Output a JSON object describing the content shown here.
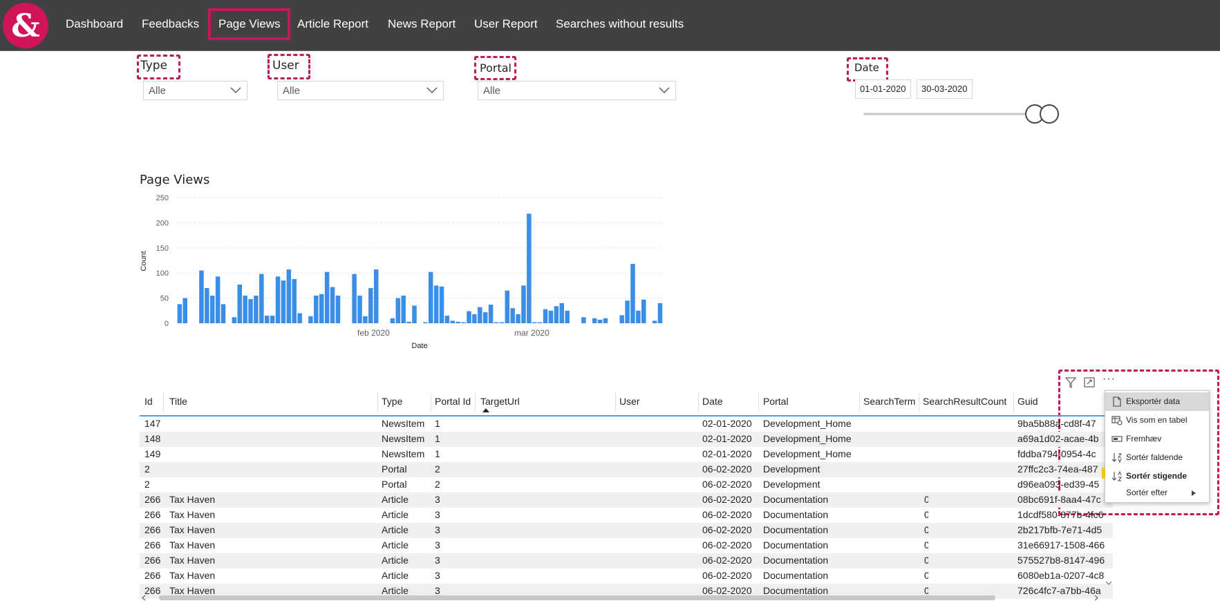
{
  "nav": {
    "items": [
      {
        "label": "Dashboard",
        "active": false
      },
      {
        "label": "Feedbacks",
        "active": false
      },
      {
        "label": "Page Views",
        "active": true
      },
      {
        "label": "Article Report",
        "active": false
      },
      {
        "label": "News Report",
        "active": false
      },
      {
        "label": "User Report",
        "active": false
      },
      {
        "label": "Searches without results",
        "active": false
      }
    ],
    "logo_icon": "ampersand-logo-icon",
    "logo_glyph": "&"
  },
  "filters": {
    "type": {
      "title": "Type",
      "value": "Alle"
    },
    "user": {
      "title": "User",
      "value": "Alle"
    },
    "portal": {
      "title": "Portal",
      "value": "Alle"
    },
    "date": {
      "title": "Date",
      "from": "01-01-2020",
      "to": "30-03-2020"
    }
  },
  "chart_data": {
    "type": "bar",
    "title": "Page Views",
    "xlabel": "Date",
    "ylabel": "Count",
    "ylim": [
      0,
      250
    ],
    "yticks": [
      0,
      50,
      100,
      150,
      200,
      250
    ],
    "xticks": [
      {
        "label": "feb 2020",
        "index": 36
      },
      {
        "label": "mar 2020",
        "index": 65
      }
    ],
    "grid": true,
    "color": "#3a8ee6",
    "values": [
      38,
      50,
      0,
      0,
      105,
      70,
      55,
      93,
      38,
      0,
      12,
      77,
      55,
      48,
      55,
      98,
      15,
      15,
      93,
      85,
      107,
      88,
      20,
      0,
      14,
      55,
      58,
      102,
      72,
      55,
      0,
      0,
      98,
      55,
      14,
      70,
      107,
      0,
      0,
      10,
      50,
      55,
      3,
      35,
      0,
      2,
      102,
      75,
      73,
      15,
      5,
      3,
      2,
      24,
      18,
      32,
      22,
      37,
      2,
      2,
      65,
      30,
      18,
      75,
      218,
      2,
      2,
      28,
      25,
      34,
      40,
      25,
      0,
      0,
      12,
      0,
      10,
      7,
      10,
      0,
      0,
      16,
      45,
      118,
      25,
      47,
      0,
      5,
      40
    ],
    "first_day": "2020-01-01"
  },
  "table": {
    "columns": [
      {
        "label": "Id"
      },
      {
        "label": "Title"
      },
      {
        "label": "Type"
      },
      {
        "label": "Portal Id"
      },
      {
        "label": "TargetUrl"
      },
      {
        "label": "User"
      },
      {
        "label": "Date"
      },
      {
        "label": "Portal"
      },
      {
        "label": "SearchTerm"
      },
      {
        "label": "SearchResultCount"
      },
      {
        "label": "Guid"
      }
    ],
    "rows": [
      [
        "147",
        "",
        "NewsItem",
        "1",
        "",
        "",
        "02-01-2020",
        "Development_Home",
        "",
        "",
        "9ba5b88a-cd8f-47"
      ],
      [
        "148",
        "",
        "NewsItem",
        "1",
        "",
        "",
        "02-01-2020",
        "Development_Home",
        "",
        "",
        "a69a1d02-acae-4b"
      ],
      [
        "149",
        "",
        "NewsItem",
        "1",
        "",
        "",
        "02-01-2020",
        "Development_Home",
        "",
        "",
        "fddba794-0954-4c"
      ],
      [
        "2",
        "",
        "Portal",
        "2",
        "",
        "",
        "06-02-2020",
        "Development",
        "",
        "",
        "27ffc2c3-74ea-487"
      ],
      [
        "2",
        "",
        "Portal",
        "2",
        "",
        "",
        "06-02-2020",
        "Development",
        "",
        "",
        "d96ea093-ed39-45"
      ],
      [
        "266",
        "Tax Haven",
        "Article",
        "3",
        "",
        "",
        "06-02-2020",
        "Documentation",
        "",
        "0",
        "08bc691f-8aa4-47c"
      ],
      [
        "266",
        "Tax Haven",
        "Article",
        "3",
        "",
        "",
        "06-02-2020",
        "Documentation",
        "",
        "0",
        "1dcdf580-877b-4fc6"
      ],
      [
        "266",
        "Tax Haven",
        "Article",
        "3",
        "",
        "",
        "06-02-2020",
        "Documentation",
        "",
        "0",
        "2b217bfb-7e71-4d5"
      ],
      [
        "266",
        "Tax Haven",
        "Article",
        "3",
        "",
        "",
        "06-02-2020",
        "Documentation",
        "",
        "0",
        "31e66917-1508-466"
      ],
      [
        "266",
        "Tax Haven",
        "Article",
        "3",
        "",
        "",
        "06-02-2020",
        "Documentation",
        "",
        "0",
        "575527b8-8147-496"
      ],
      [
        "266",
        "Tax Haven",
        "Article",
        "3",
        "",
        "",
        "06-02-2020",
        "Documentation",
        "",
        "0",
        "6080eb1a-0207-4c8"
      ],
      [
        "266",
        "Tax Haven",
        "Article",
        "3",
        "",
        "",
        "06-02-2020",
        "Documentation",
        "",
        "0",
        "726c4fc7-a7bb-46a"
      ]
    ]
  },
  "visual_toolbar": {
    "filter_icon": "filter-icon",
    "focus_icon": "focus-mode-icon",
    "more_icon": "more-options-icon",
    "more_label": "···"
  },
  "context_menu": {
    "items": [
      {
        "label": "Eksportér data",
        "icon": "export-icon"
      },
      {
        "label": "Vis som en tabel",
        "icon": "table-view-icon"
      },
      {
        "label": "Fremhæv",
        "icon": "spotlight-icon"
      },
      {
        "label": "Sortér faldende",
        "icon": "sort-descending-icon"
      },
      {
        "label": "Sortér stigende",
        "icon": "sort-ascending-icon"
      },
      {
        "label": "Sortér efter",
        "icon": "chevron-right-icon"
      }
    ]
  },
  "colors": {
    "navbar": "#414141",
    "highlight": "#c2185b",
    "logo": "#d1145a",
    "bar": "#3a8ee6"
  }
}
